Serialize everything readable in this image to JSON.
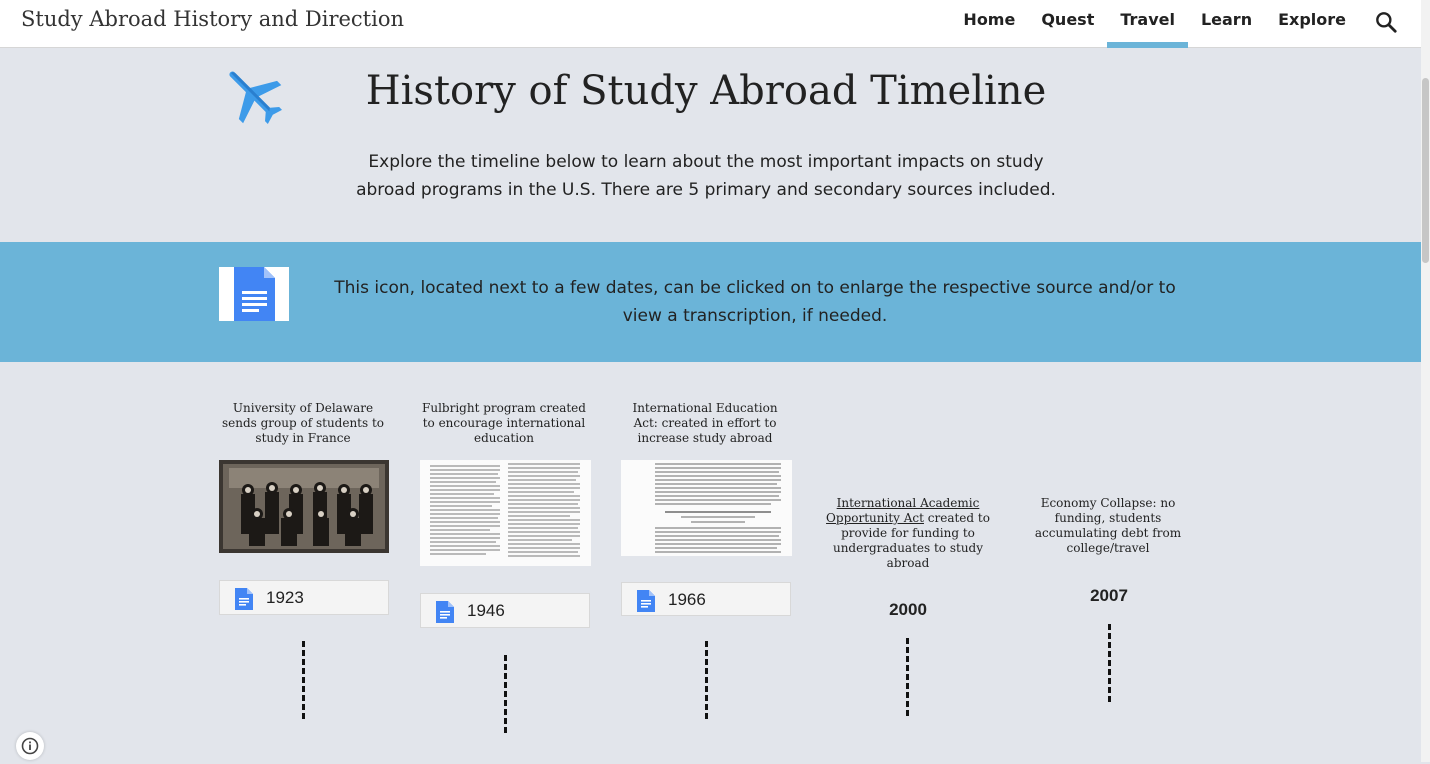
{
  "site": {
    "title": "Study Abroad History and Direction"
  },
  "nav": {
    "items": [
      {
        "label": "Home"
      },
      {
        "label": "Quest"
      },
      {
        "label": "Travel",
        "active": true
      },
      {
        "label": "Learn"
      },
      {
        "label": "Explore"
      }
    ],
    "search_icon": "search-icon"
  },
  "hero": {
    "icon": "airplane-icon",
    "title": "History of Study Abroad Timeline",
    "intro": "Explore the timeline below to learn about the most important impacts on study abroad programs in the U.S. There are 5 primary and secondary sources included."
  },
  "notice": {
    "icon": "google-docs-icon",
    "text": "This icon, located next to a few dates, can be clicked on to enlarge the respective source and/or to view a transcription, if needed."
  },
  "timeline": [
    {
      "caption": "University of Delaware sends group of students to study in France",
      "date": "1923",
      "has_doc": true
    },
    {
      "caption": "Fulbright program created to encourage international education",
      "date": "1946",
      "has_doc": true
    },
    {
      "caption": "International Education Act: created in effort to increase study abroad",
      "date": "1966",
      "has_doc": true
    },
    {
      "caption_link": "International Academic Opportunity Act",
      "caption_rest": " created to provide for funding to undergraduates to study abroad",
      "date": "2000",
      "has_doc": false
    },
    {
      "caption": "Economy Collapse:  no funding, students accumulating debt from college/travel",
      "date": "2007",
      "has_doc": false
    }
  ],
  "colors": {
    "band": "#6bb4d8",
    "background": "#e2e5eb",
    "doc_blue": "#4285f4",
    "plane_blue": "#3d9be9"
  }
}
